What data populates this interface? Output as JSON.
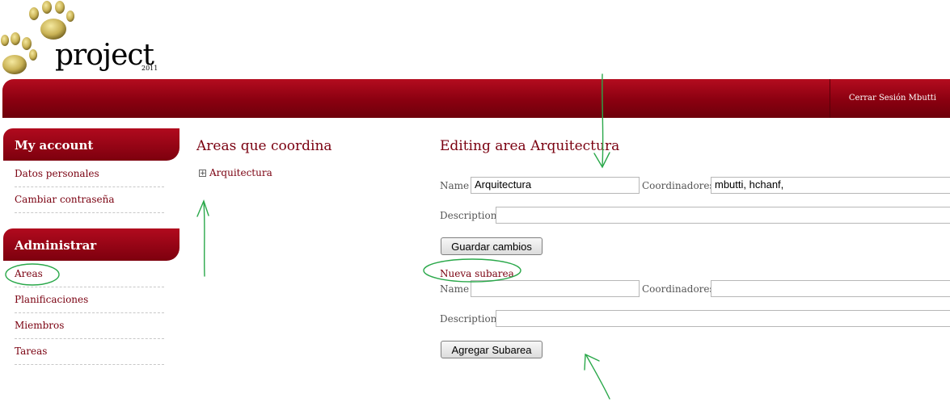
{
  "header": {
    "brand": "project",
    "year": "2011",
    "logout_link": "Cerrar Sesión Mbutti"
  },
  "sidebar": {
    "account": {
      "title": "My account",
      "items": [
        "Datos personales",
        "Cambiar contraseña"
      ]
    },
    "admin": {
      "title": "Administrar",
      "items": [
        "Areas",
        "Planificaciones",
        "Miembros",
        "Tareas"
      ]
    }
  },
  "areas_panel": {
    "title": "Areas que coordina",
    "tree_items": [
      "Arquitectura"
    ],
    "expander": "+"
  },
  "edit_form": {
    "title": "Editing area Arquitectura",
    "name_label": "Name",
    "name_value": "Arquitectura",
    "coord_label": "Coordinadores",
    "coord_value": "mbutti, hchanf,",
    "desc_label": "Description",
    "desc_value": "",
    "save_button": "Guardar cambios"
  },
  "new_subarea": {
    "title": "Nueva subarea",
    "name_label": "Name",
    "name_value": "",
    "coord_label": "Coordinadores",
    "coord_value": "",
    "desc_label": "Description",
    "desc_value": "",
    "add_button": "Agregar Subarea"
  },
  "colors": {
    "brand_red": "#8a0010",
    "link_red": "#7a0010",
    "annotation_green": "#2aa84a",
    "paw_gold": "#c9b255"
  }
}
